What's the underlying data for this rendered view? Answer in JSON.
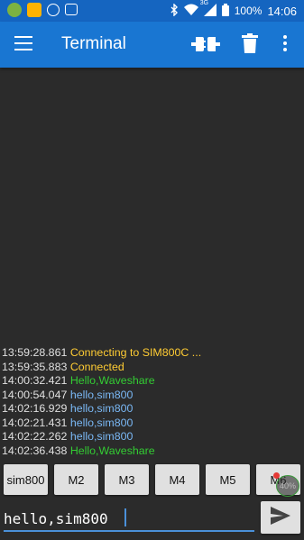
{
  "status_bar": {
    "battery": "100%",
    "network": "3G",
    "time": "14:06"
  },
  "app_bar": {
    "title": "Terminal"
  },
  "colors": {
    "app_bar": "#1976d2",
    "status_bar": "#1565c0",
    "background": "#2b2b2b",
    "status_msg": "#ffcc33",
    "received_msg": "#33cc33",
    "sent_msg": "#7ab8f5"
  },
  "log": [
    {
      "ts": "13:59:28.861",
      "msg": "Connecting to SIM800C ...",
      "kind": "status"
    },
    {
      "ts": "13:59:35.883",
      "msg": "Connected",
      "kind": "status"
    },
    {
      "ts": "14:00:32.421",
      "msg": "Hello,Waveshare",
      "kind": "recv"
    },
    {
      "ts": "14:00:54.047",
      "msg": "hello,sim800",
      "kind": "sent"
    },
    {
      "ts": "14:02:16.929",
      "msg": "hello,sim800",
      "kind": "sent"
    },
    {
      "ts": "14:02:21.431",
      "msg": "hello,sim800",
      "kind": "sent"
    },
    {
      "ts": "14:02:22.262",
      "msg": "hello,sim800",
      "kind": "sent"
    },
    {
      "ts": "14:02:36.438",
      "msg": "Hello,Waveshare",
      "kind": "recv"
    }
  ],
  "macros": [
    "sim800",
    "M2",
    "M3",
    "M4",
    "M5",
    "M6"
  ],
  "overlay_badge": "40%",
  "input": {
    "value": "hello,sim800"
  },
  "icons": {
    "menu": "hamburger-icon",
    "connect": "connect-plug-icon",
    "delete": "trash-icon",
    "more": "more-vert-icon",
    "send": "send-icon"
  }
}
